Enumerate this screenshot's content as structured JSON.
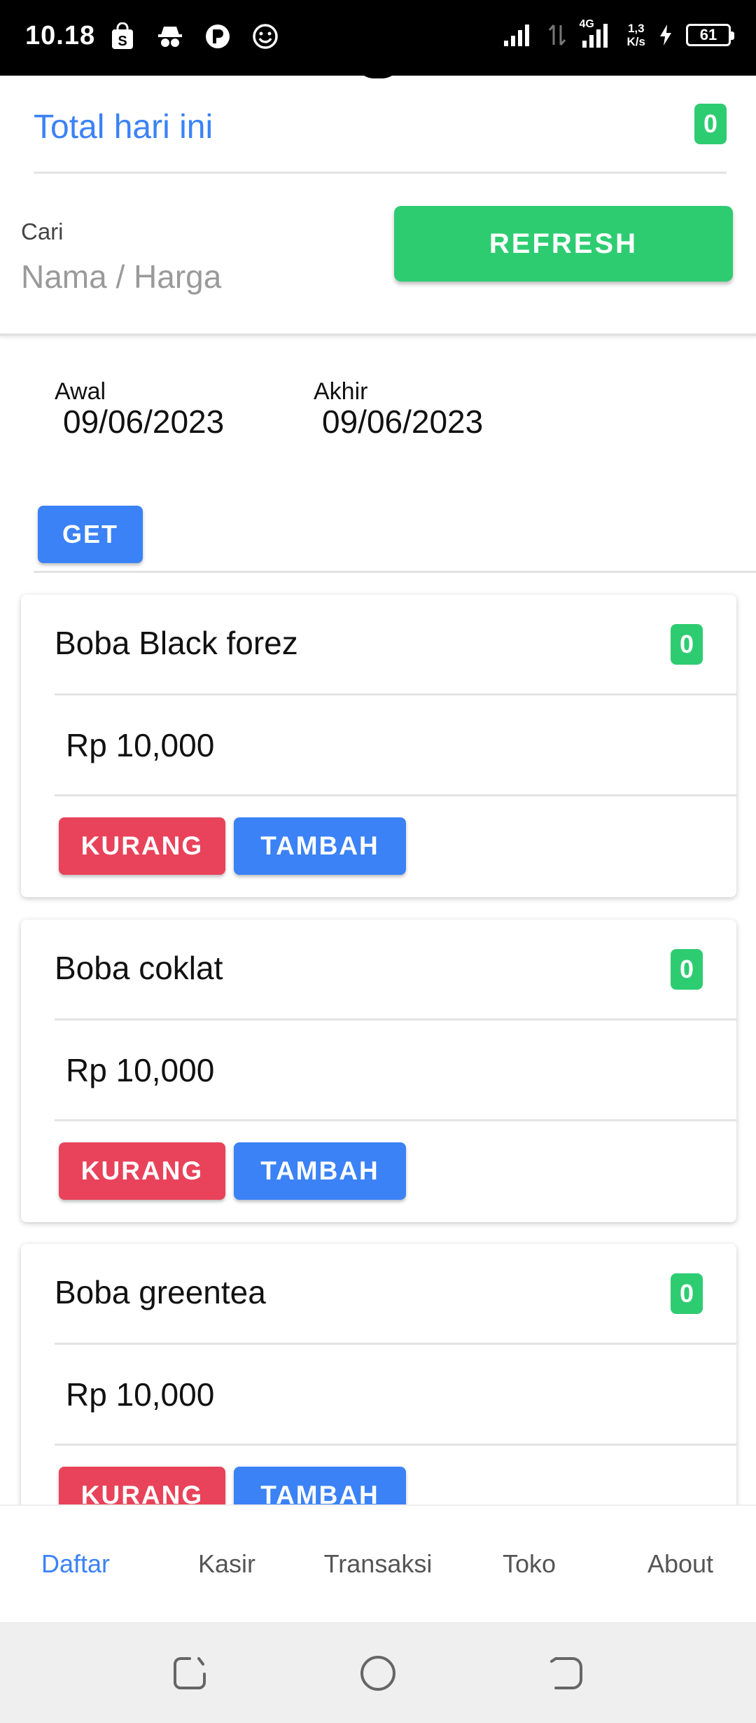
{
  "status_bar": {
    "time": "10.18",
    "network_type": "4G",
    "net_speed_value": "1,3",
    "net_speed_unit": "K/s",
    "battery": "61"
  },
  "header": {
    "total_label": "Total hari ini",
    "total_count": "0"
  },
  "search": {
    "label": "Cari",
    "placeholder": "Nama / Harga",
    "value": "",
    "refresh_label": "REFRESH"
  },
  "date_range": {
    "start_label": "Awal",
    "start_value": "09/06/2023",
    "end_label": "Akhir",
    "end_value": "09/06/2023",
    "get_label": "GET"
  },
  "products": [
    {
      "name": "Boba Black forez",
      "count": "0",
      "price": "Rp 10,000",
      "decrease_label": "KURANG",
      "increase_label": "TAMBAH"
    },
    {
      "name": "Boba coklat",
      "count": "0",
      "price": "Rp 10,000",
      "decrease_label": "KURANG",
      "increase_label": "TAMBAH"
    },
    {
      "name": "Boba greentea",
      "count": "0",
      "price": "Rp 10,000",
      "decrease_label": "KURANG",
      "increase_label": "TAMBAH"
    }
  ],
  "bottom_nav": {
    "tabs": [
      {
        "label": "Daftar",
        "active": true
      },
      {
        "label": "Kasir",
        "active": false
      },
      {
        "label": "Transaksi",
        "active": false
      },
      {
        "label": "Toko",
        "active": false
      },
      {
        "label": "About",
        "active": false
      }
    ]
  },
  "colors": {
    "accent_blue": "#3b82f6",
    "success_green": "#2ecc71",
    "danger_red": "#e8435a"
  }
}
